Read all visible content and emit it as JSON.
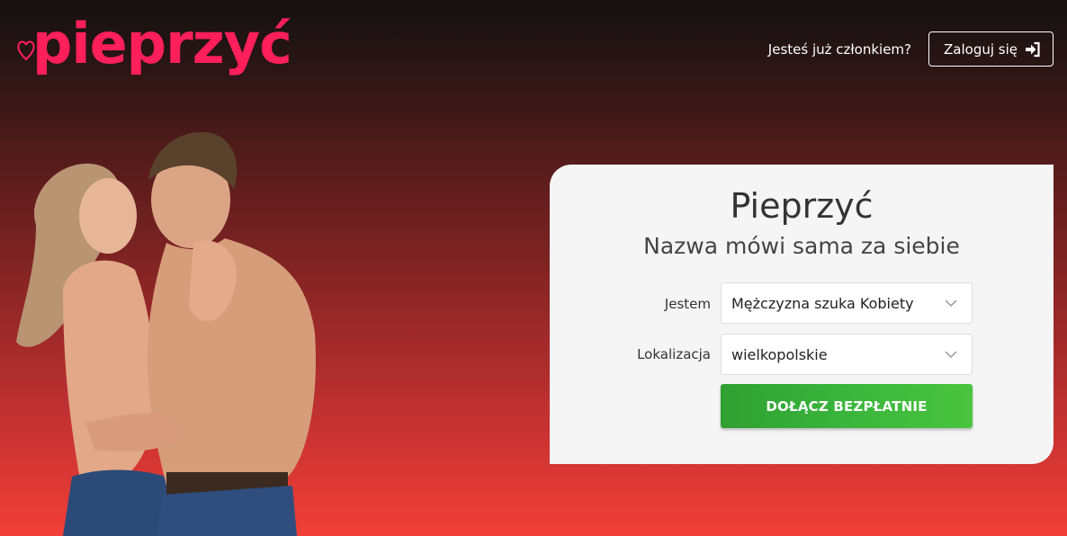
{
  "header": {
    "logo_text": "pieprzyć",
    "member_question": "Jesteś już członkiem?",
    "login_label": "Zaloguj się"
  },
  "form": {
    "title": "Pieprzyć",
    "subtitle": "Nazwa mówi sama za siebie",
    "gender_label": "Jestem",
    "gender_value": "Mężczyzna szuka Kobiety",
    "location_label": "Lokalizacja",
    "location_value": "wielkopolskie",
    "join_label": "DOŁĄCZ BEZPŁATNIE"
  },
  "colors": {
    "brand": "#ff1f5a",
    "join_button": "#3ab53c",
    "card_background": "#f5f5f5"
  },
  "icons": {
    "logo": "heart-icon",
    "login": "sign-in-icon",
    "select": "chevron-down-icon"
  }
}
